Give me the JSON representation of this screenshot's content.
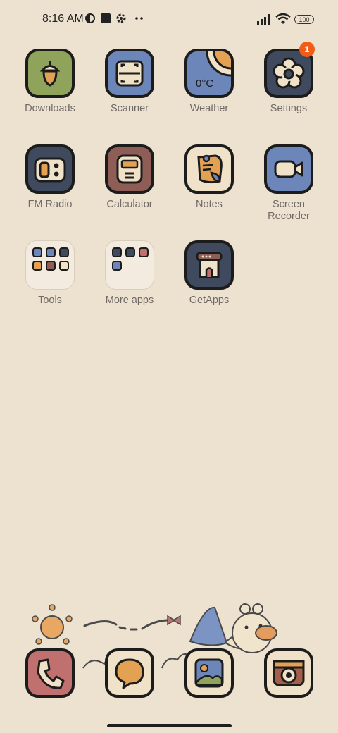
{
  "status_bar": {
    "time": "8:16 AM",
    "battery": "100",
    "icons": [
      "browser-circle-icon",
      "square-notification-icon",
      "settings-gear-icon",
      "more-dots-icon",
      "signal-icon",
      "wifi-icon",
      "battery-icon"
    ]
  },
  "apps": [
    {
      "label": "Downloads",
      "icon": "acorn-icon",
      "color": "#8fa35a"
    },
    {
      "label": "Scanner",
      "icon": "scan-icon",
      "color": "#6d86b9"
    },
    {
      "label": "Weather",
      "icon": "sun-icon",
      "color": "#6d86b9",
      "text": "0°C"
    },
    {
      "label": "Settings",
      "icon": "flower-gear-icon",
      "color": "#3f4a5e",
      "badge": "1"
    },
    {
      "label": "FM Radio",
      "icon": "radio-icon",
      "color": "#3f4a5e"
    },
    {
      "label": "Calculator",
      "icon": "calculator-icon",
      "color": "#8e5e56"
    },
    {
      "label": "Notes",
      "icon": "note-icon",
      "color": "#efe2c8"
    },
    {
      "label": "Screen Recorder",
      "label_line1": "Screen",
      "label_line2": "Recorder",
      "icon": "video-camera-icon",
      "color": "#6d86b9"
    },
    {
      "label": "Tools",
      "icon": "folder-icon"
    },
    {
      "label": "More apps",
      "icon": "folder-icon"
    },
    {
      "label": "GetApps",
      "icon": "shop-icon",
      "color": "#3f4a5e"
    }
  ],
  "dock": [
    {
      "name": "phone",
      "icon": "phone-icon",
      "color": "#c0716f"
    },
    {
      "name": "messages",
      "icon": "speech-bubble-icon",
      "color": "#efe2c8"
    },
    {
      "name": "gallery",
      "icon": "picture-icon",
      "color": "#efe2c8"
    },
    {
      "name": "camera",
      "icon": "camera-icon",
      "color": "#efe2c8"
    }
  ]
}
